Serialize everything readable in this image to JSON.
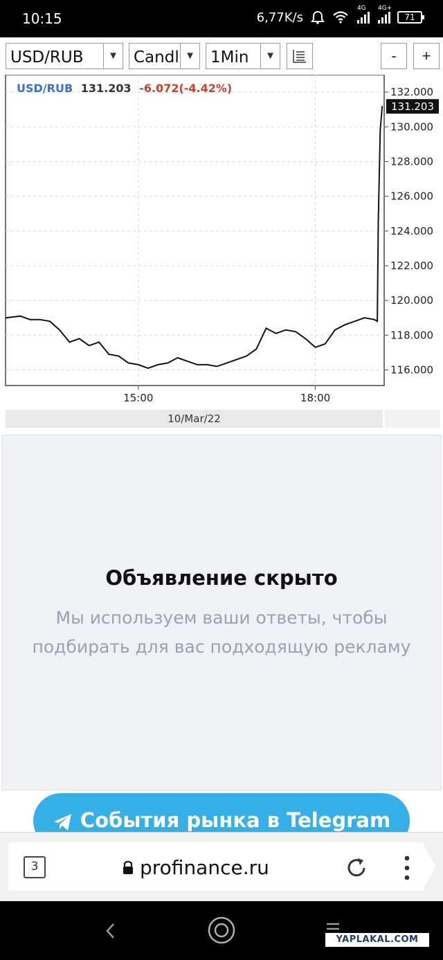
{
  "status_bar": {
    "time": "10:15",
    "speed": "6,77K/s",
    "net1": "4G",
    "net2": "4G+",
    "battery": "71"
  },
  "toolbar": {
    "pair_value": "USD/RUB",
    "chart_type_value": "Candle",
    "interval_value": "1Min",
    "zoom_out_label": "-",
    "zoom_in_label": "+",
    "dropdown_arrow": "▼"
  },
  "chart": {
    "header_symbol": "USD/RUB",
    "header_price": "131.203",
    "header_change": "-6.072(-4.42%)",
    "price_label": "131.203",
    "date_label": "10/Mar/22",
    "colors": {
      "symbol": "#3b6fd4",
      "change": "#d04028",
      "line": "#111111",
      "grid": "#d9d9d9"
    }
  },
  "chart_data": {
    "type": "line",
    "title": "USD/RUB 131.203 -6.072(-4.42%)",
    "x_tick_labels": [
      "15:00",
      "18:00"
    ],
    "y_tick_labels": [
      "132.000",
      "130.000",
      "128.000",
      "126.000",
      "124.000",
      "122.000",
      "120.000",
      "118.000",
      "116.000"
    ],
    "ylim": [
      115.1,
      133.0
    ],
    "xlim": [
      "12:45",
      "19:10"
    ],
    "grid": true,
    "series": [
      {
        "values": [
          {
            "x": "12:45",
            "y": 119.0
          },
          {
            "x": "13:00",
            "y": 119.1
          },
          {
            "x": "13:10",
            "y": 118.9
          },
          {
            "x": "13:20",
            "y": 118.9
          },
          {
            "x": "13:30",
            "y": 118.8
          },
          {
            "x": "13:40",
            "y": 118.3
          },
          {
            "x": "13:50",
            "y": 117.6
          },
          {
            "x": "14:00",
            "y": 117.8
          },
          {
            "x": "14:10",
            "y": 117.4
          },
          {
            "x": "14:20",
            "y": 117.6
          },
          {
            "x": "14:30",
            "y": 116.9
          },
          {
            "x": "14:40",
            "y": 116.8
          },
          {
            "x": "14:50",
            "y": 116.4
          },
          {
            "x": "15:00",
            "y": 116.3
          },
          {
            "x": "15:10",
            "y": 116.1
          },
          {
            "x": "15:20",
            "y": 116.3
          },
          {
            "x": "15:30",
            "y": 116.4
          },
          {
            "x": "15:40",
            "y": 116.7
          },
          {
            "x": "15:50",
            "y": 116.5
          },
          {
            "x": "16:00",
            "y": 116.3
          },
          {
            "x": "16:10",
            "y": 116.3
          },
          {
            "x": "16:20",
            "y": 116.2
          },
          {
            "x": "16:30",
            "y": 116.4
          },
          {
            "x": "16:40",
            "y": 116.6
          },
          {
            "x": "16:50",
            "y": 116.8
          },
          {
            "x": "17:00",
            "y": 117.2
          },
          {
            "x": "17:10",
            "y": 118.4
          },
          {
            "x": "17:20",
            "y": 118.1
          },
          {
            "x": "17:30",
            "y": 118.3
          },
          {
            "x": "17:40",
            "y": 118.2
          },
          {
            "x": "17:50",
            "y": 117.8
          },
          {
            "x": "18:00",
            "y": 117.3
          },
          {
            "x": "18:10",
            "y": 117.5
          },
          {
            "x": "18:20",
            "y": 118.3
          },
          {
            "x": "18:30",
            "y": 118.6
          },
          {
            "x": "18:40",
            "y": 118.8
          },
          {
            "x": "18:50",
            "y": 119.0
          },
          {
            "x": "19:00",
            "y": 118.9
          },
          {
            "x": "19:03",
            "y": 118.8
          },
          {
            "x": "19:04",
            "y": 124.5
          },
          {
            "x": "19:06",
            "y": 129.8
          },
          {
            "x": "19:08",
            "y": 131.2
          }
        ]
      }
    ]
  },
  "ad": {
    "title": "Объявление скрыто",
    "text": "Мы используем ваши ответы, чтобы подбирать для вас подходящую рекламу"
  },
  "telegram_button": {
    "label": "События рынка в Telegram"
  },
  "browser": {
    "tab_count": "3",
    "url": "profinance.ru"
  },
  "watermark": {
    "text": "YAPLAKAL.COM"
  }
}
